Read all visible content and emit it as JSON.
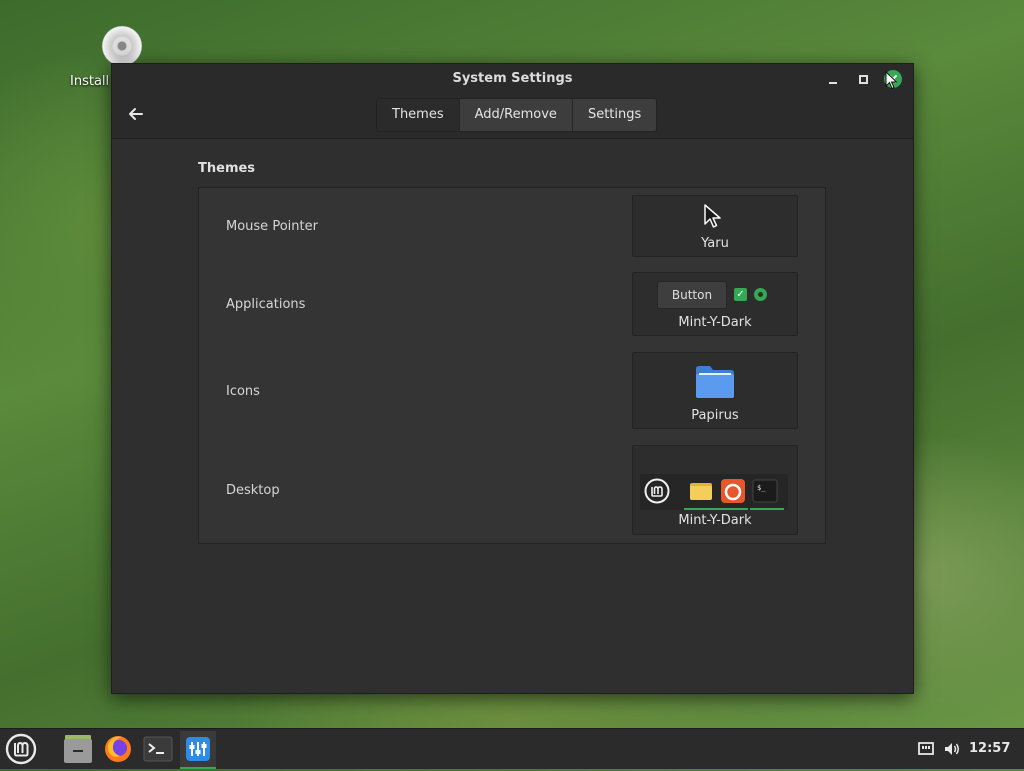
{
  "desktop": {
    "icon_label": "Install"
  },
  "window": {
    "title": "System Settings",
    "tabs": [
      "Themes",
      "Add/Remove",
      "Settings"
    ],
    "active_tab": "Themes"
  },
  "themes": {
    "section_title": "Themes",
    "rows": [
      {
        "label": "Mouse Pointer",
        "value": "Yaru"
      },
      {
        "label": "Applications",
        "value": "Mint-Y-Dark",
        "button_preview": "Button"
      },
      {
        "label": "Icons",
        "value": "Papirus"
      },
      {
        "label": "Desktop",
        "value": "Mint-Y-Dark"
      }
    ]
  },
  "taskbar": {
    "clock": "12:57"
  },
  "colors": {
    "accent": "#35a853",
    "window_bg": "#2f2f2f",
    "panel_bg": "#2b2b2b"
  }
}
